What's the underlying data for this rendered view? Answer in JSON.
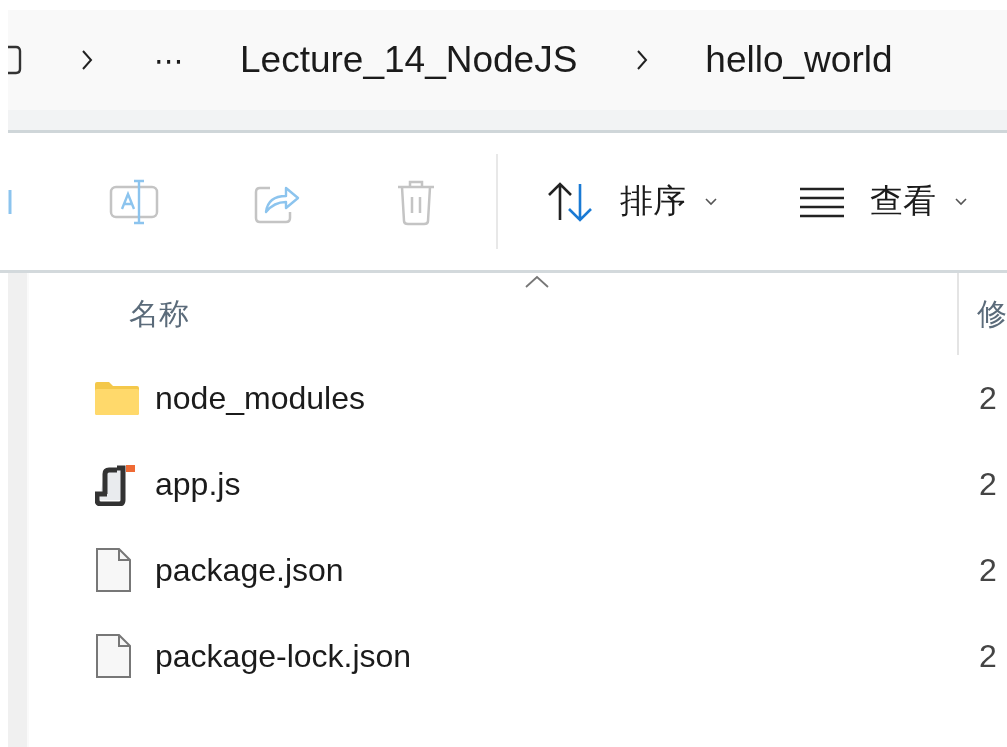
{
  "address_bar": {
    "path": [
      {
        "kind": "ellipsis",
        "label": "⋯"
      },
      {
        "kind": "folder",
        "label": "Lecture_14_NodeJS"
      },
      {
        "kind": "folder",
        "label": "hello_world"
      }
    ]
  },
  "toolbar": {
    "buttons": [
      {
        "kind": "rename",
        "disabled": true
      },
      {
        "kind": "share",
        "disabled": true
      },
      {
        "kind": "delete",
        "disabled": true
      }
    ],
    "sort": {
      "label": "排序"
    },
    "view": {
      "label": "查看"
    }
  },
  "file_list": {
    "columns": [
      {
        "label": "名称",
        "sorted": true
      },
      {
        "label": "修",
        "sorted": false
      }
    ],
    "rows": [
      {
        "kind": "folder",
        "name": "node_modules",
        "column_2": "2"
      },
      {
        "kind": "js",
        "name": "app.js",
        "column_2": "2"
      },
      {
        "kind": "file",
        "name": "package.json",
        "column_2": "2"
      },
      {
        "kind": "file",
        "name": "package-lock.json",
        "column_2": "2"
      }
    ]
  }
}
